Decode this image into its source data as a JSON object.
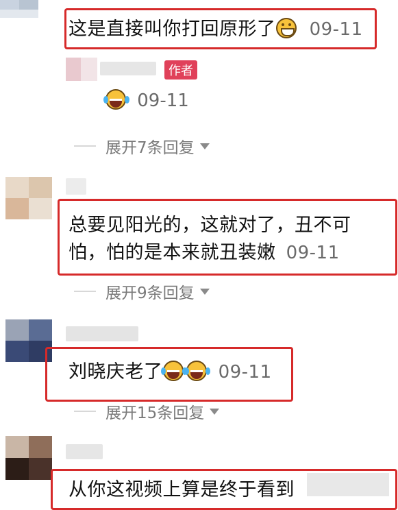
{
  "comments": [
    {
      "text": "这是直接叫你打回原形了",
      "emoji": "grinning-face-icon",
      "date": "09-11"
    },
    {
      "text_line1": "总要见阳光的，这就对了，丑不可",
      "text_line2": "怕，怕的是本来就丑装嫩",
      "date": "09-11",
      "expand_label": "展开9条回复"
    },
    {
      "text": "刘晓庆老了",
      "emoji": "laughing-tears-face-icon",
      "date": "09-11",
      "expand_label": "展开15条回复"
    },
    {
      "text": "从你这视频上算是终于看到"
    }
  ],
  "reply": {
    "author_badge": "作者",
    "emoji": "laughing-tears-face-icon",
    "date": "09-11",
    "expand_label": "展开7条回复"
  },
  "colors": {
    "highlight_border": "#d62a2a",
    "author_badge": "#e0415a",
    "meta_text": "#7a7a7a"
  }
}
